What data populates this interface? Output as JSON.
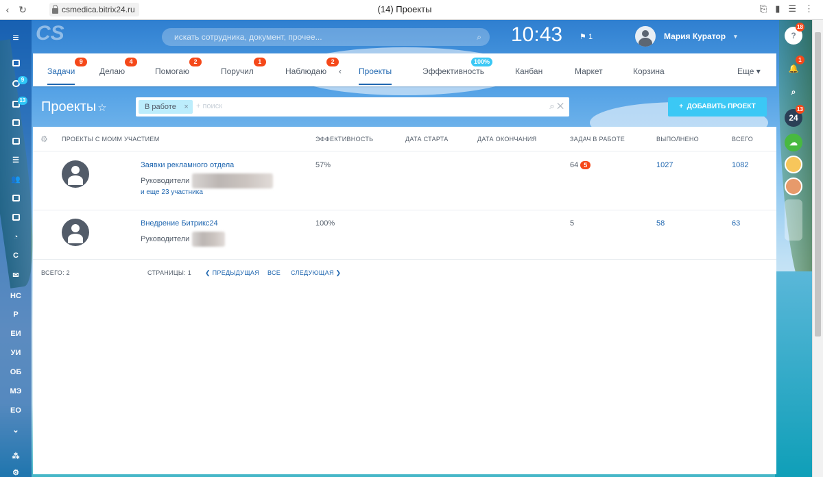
{
  "browser": {
    "url": "csmedica.bitrix24.ru",
    "page_title": "(14) Проекты",
    "back_icon": "back-arrow-icon",
    "reload_icon": "reload-icon"
  },
  "header": {
    "search_placeholder": "искать сотрудника, документ, прочее...",
    "time": "10:43",
    "flag_count": "1",
    "user_name": "Мария Куратор"
  },
  "right_sidebar": {
    "help_count": "18",
    "notif_count": "1",
    "b24_label": "24",
    "b24_count": "13"
  },
  "left_sidebar": {
    "tasks_count": "9",
    "chat_count": "13",
    "groups": [
      "С",
      "НС",
      "Р",
      "ЕИ",
      "УИ",
      "ОБ",
      "МЭ",
      "ЕО"
    ]
  },
  "menu": {
    "items": [
      {
        "label": "Задачи",
        "count": "9"
      },
      {
        "label": "Делаю",
        "count": "4"
      },
      {
        "label": "Помогаю",
        "count": "2"
      },
      {
        "label": "Поручил",
        "count": "1"
      },
      {
        "label": "Наблюдаю",
        "count": "2"
      },
      {
        "label": "Проекты",
        "count": ""
      },
      {
        "label": "Эффективность",
        "count": "100%"
      },
      {
        "label": "Канбан",
        "count": ""
      },
      {
        "label": "Маркет",
        "count": ""
      },
      {
        "label": "Корзина",
        "count": ""
      }
    ],
    "more": "Еще ▾"
  },
  "page": {
    "title": "Проекты",
    "filter_tag": "В работе",
    "filter_placeholder": "+ поиск",
    "add_button": "ДОБАВИТЬ ПРОЕКТ",
    "add_plus": "+"
  },
  "table": {
    "headers": [
      "ПРОЕКТЫ С МОИМ УЧАСТИЕМ",
      "ЭФФЕКТИВНОСТЬ",
      "ДАТА СТАРТА",
      "ДАТА ОКОНЧАНИЯ",
      "ЗАДАЧ В РАБОТЕ",
      "ВЫПОЛНЕНО",
      "ВСЕГО"
    ],
    "rows": [
      {
        "name": "Заявки рекламного отдела",
        "leaders_label": "Руководители",
        "more": "и еще 23 участника",
        "efficiency": "57%",
        "start": "",
        "end": "",
        "tasks": "64",
        "tasks_badge": "5",
        "done": "1027",
        "total": "1082"
      },
      {
        "name": "Внедрение Битрикс24",
        "leaders_label": "Руководители",
        "more": "",
        "efficiency": "100%",
        "start": "",
        "end": "",
        "tasks": "5",
        "tasks_badge": "",
        "done": "58",
        "total": "63"
      }
    ]
  },
  "footer": {
    "total": "ВСЕГО: 2",
    "pages": "СТРАНИЦЫ: 1",
    "prev": "❮ ПРЕДЫДУЩАЯ",
    "all": "ВСЕ",
    "next": "СЛЕДУЮЩАЯ ❯"
  }
}
